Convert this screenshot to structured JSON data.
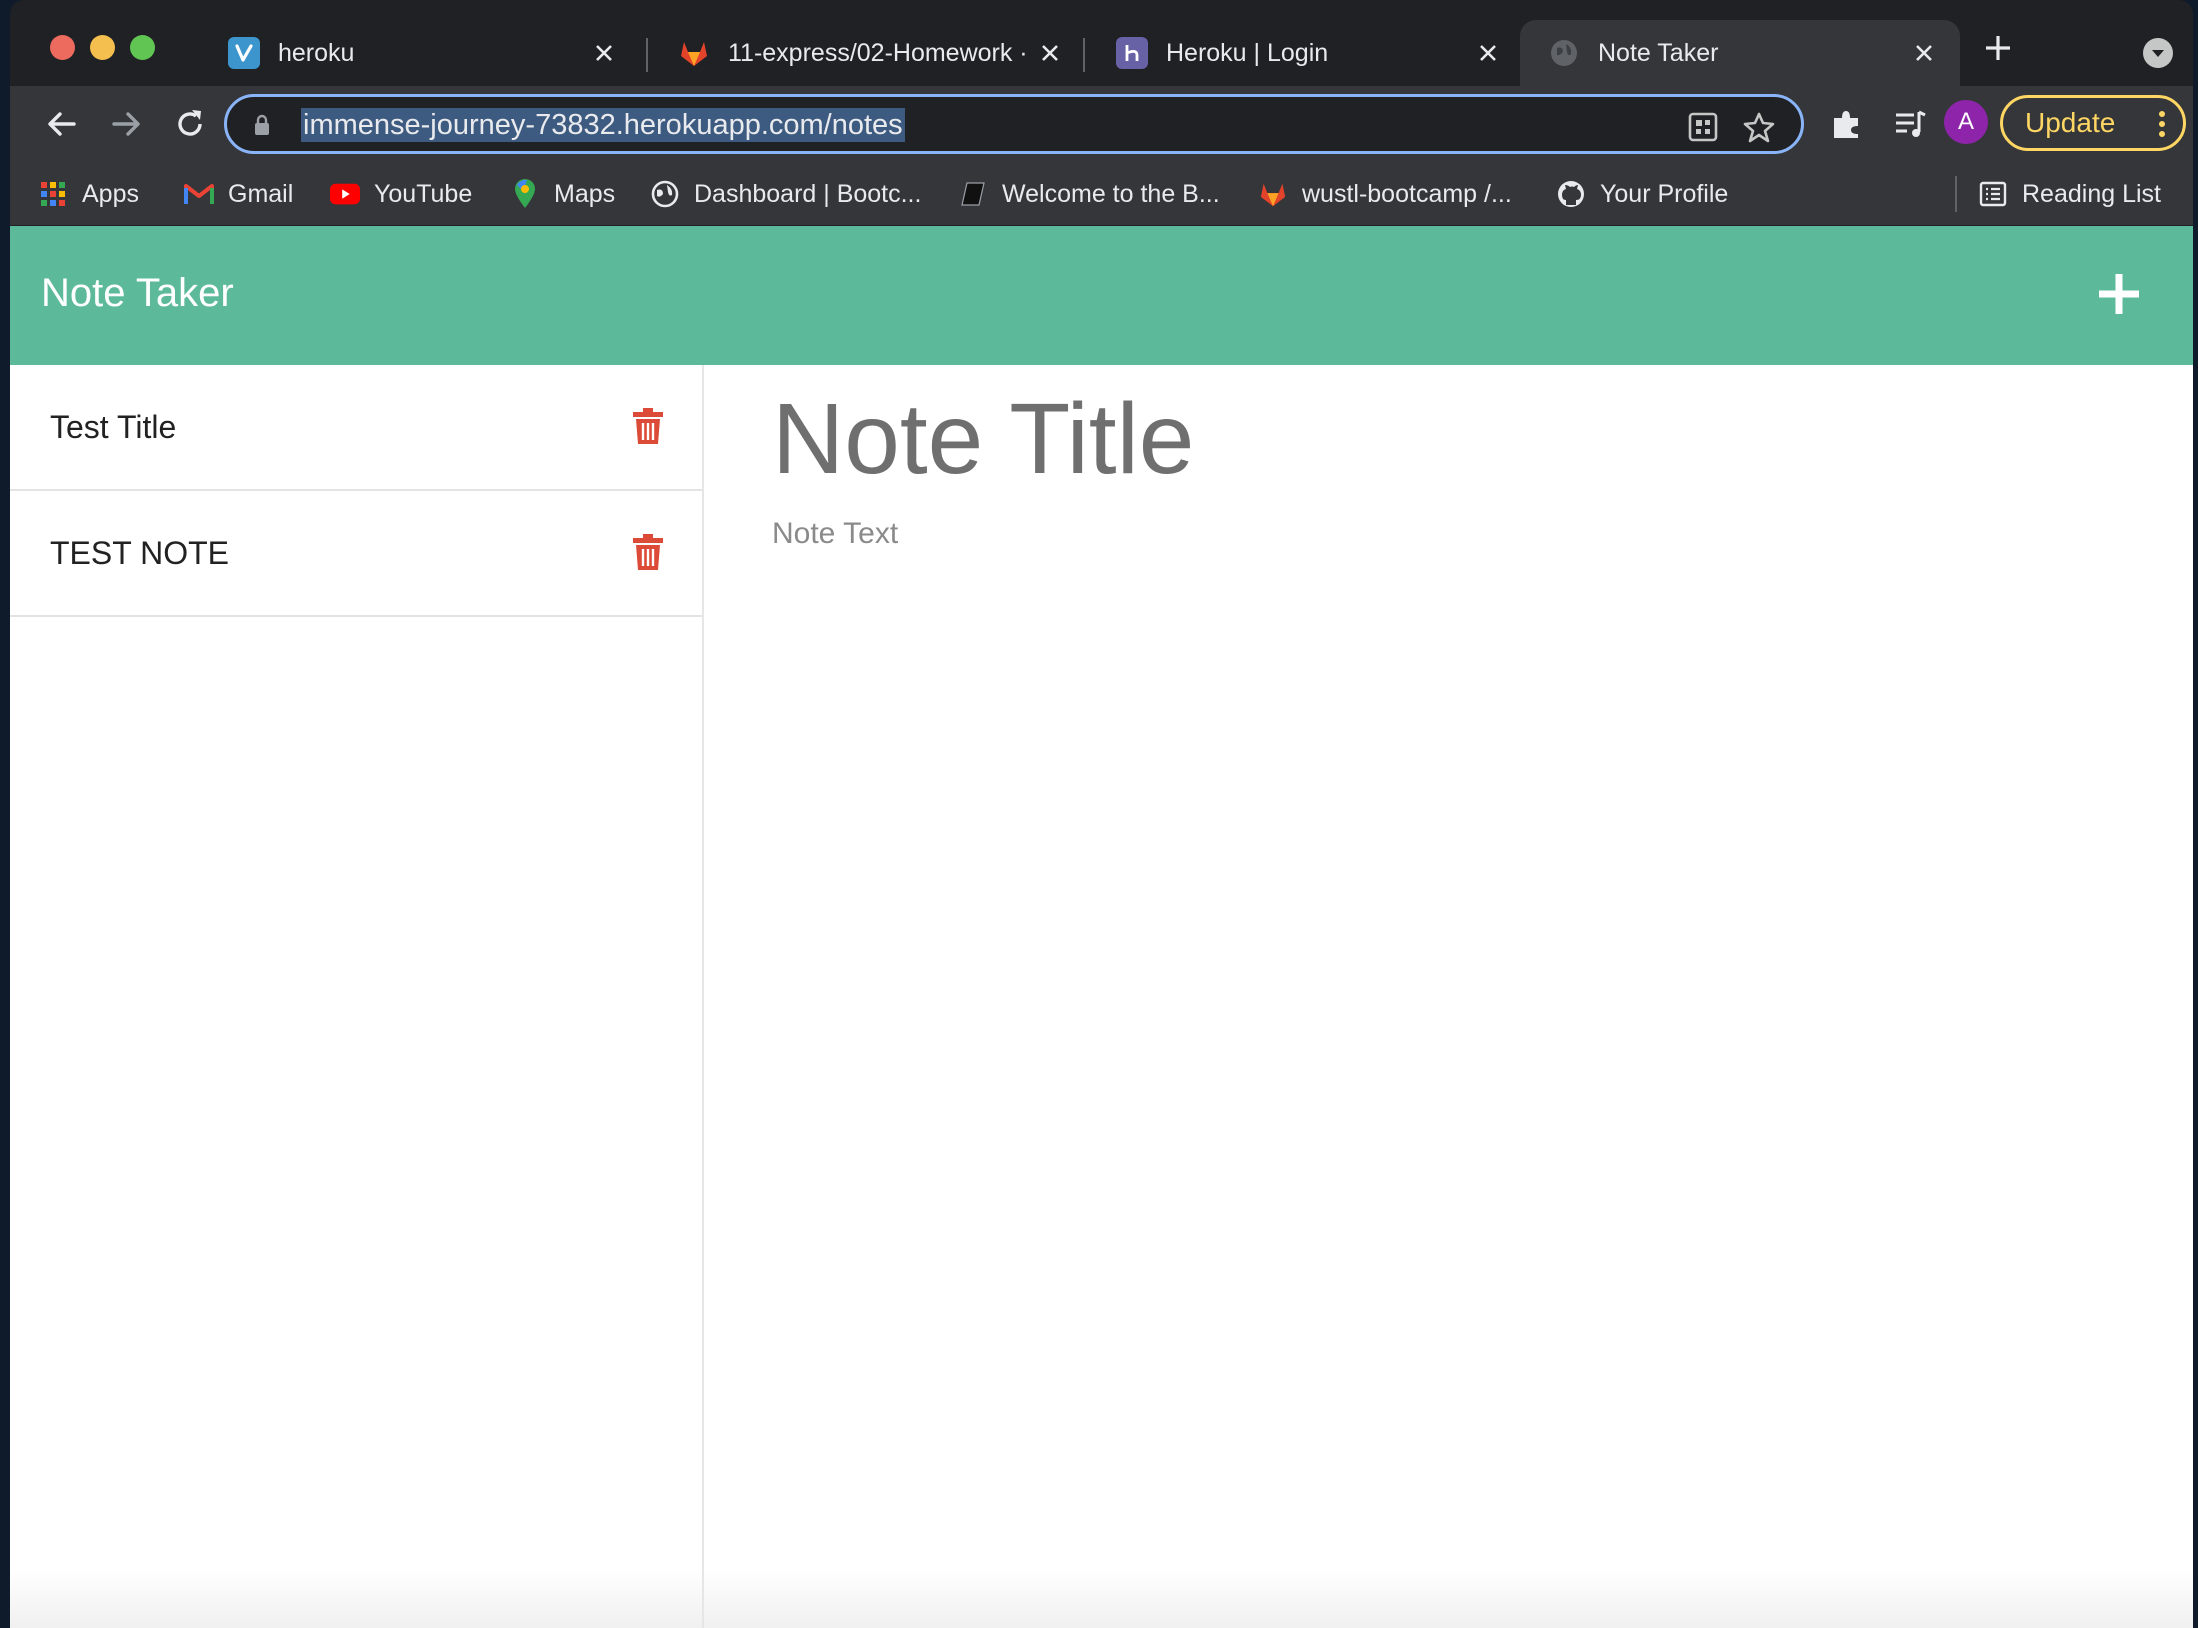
{
  "browser": {
    "tabs": [
      {
        "title": "heroku",
        "favicon": "venmo-v-icon",
        "active": false
      },
      {
        "title": "11-express/02-Homework ·",
        "favicon": "gitlab-fox-icon",
        "active": false
      },
      {
        "title": "Heroku | Login",
        "favicon": "heroku-h-icon",
        "active": false
      },
      {
        "title": "Note Taker",
        "favicon": "globe-icon",
        "active": true
      }
    ],
    "url": "immense-journey-73832.herokuapp.com/notes",
    "profile_initial": "A",
    "update_label": "Update",
    "bookmarks": [
      {
        "label": "Apps",
        "icon": "apps-grid-icon"
      },
      {
        "label": "Gmail",
        "icon": "gmail-icon"
      },
      {
        "label": "YouTube",
        "icon": "youtube-icon"
      },
      {
        "label": "Maps",
        "icon": "maps-pin-icon"
      },
      {
        "label": "Dashboard | Bootc...",
        "icon": "globe-icon"
      },
      {
        "label": "Welcome to the B...",
        "icon": "book-icon"
      },
      {
        "label": "wustl-bootcamp /...",
        "icon": "gitlab-fox-icon"
      },
      {
        "label": "Your Profile",
        "icon": "github-icon"
      }
    ],
    "reading_list_label": "Reading List"
  },
  "app": {
    "title": "Note Taker",
    "notes": [
      {
        "title": "Test Title"
      },
      {
        "title": "TEST NOTE"
      }
    ],
    "editor": {
      "title_placeholder": "Note Title",
      "text_placeholder": "Note Text"
    },
    "colors": {
      "header": "#5cba9b",
      "delete": "#dc4a38",
      "url_highlight": "#3d5a80",
      "update": "#fdd663"
    }
  }
}
